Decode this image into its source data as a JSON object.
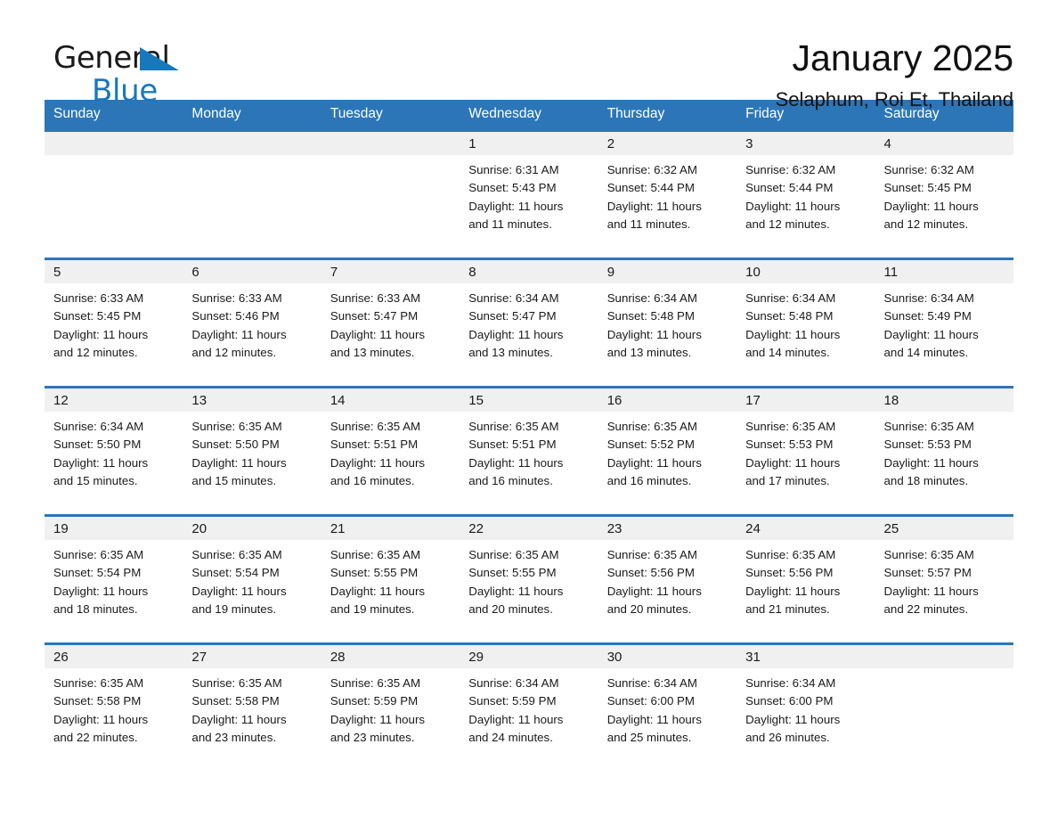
{
  "brand": {
    "name_part1": "General",
    "name_part2": "Blue",
    "accent_color": "#1878bd",
    "triangle_icon": "triangle-logo-icon"
  },
  "header": {
    "title": "January 2025",
    "location": "Selaphum, Roi Et, Thailand"
  },
  "calendar": {
    "header_bg": "#2c76b8",
    "daynum_bg": "#f0f0f0",
    "weekdays": [
      "Sunday",
      "Monday",
      "Tuesday",
      "Wednesday",
      "Thursday",
      "Friday",
      "Saturday"
    ],
    "weeks": [
      [
        {
          "day": "",
          "sunrise": "",
          "sunset": "",
          "daylight1": "",
          "daylight2": ""
        },
        {
          "day": "",
          "sunrise": "",
          "sunset": "",
          "daylight1": "",
          "daylight2": ""
        },
        {
          "day": "",
          "sunrise": "",
          "sunset": "",
          "daylight1": "",
          "daylight2": ""
        },
        {
          "day": "1",
          "sunrise": "Sunrise: 6:31 AM",
          "sunset": "Sunset: 5:43 PM",
          "daylight1": "Daylight: 11 hours",
          "daylight2": "and 11 minutes."
        },
        {
          "day": "2",
          "sunrise": "Sunrise: 6:32 AM",
          "sunset": "Sunset: 5:44 PM",
          "daylight1": "Daylight: 11 hours",
          "daylight2": "and 11 minutes."
        },
        {
          "day": "3",
          "sunrise": "Sunrise: 6:32 AM",
          "sunset": "Sunset: 5:44 PM",
          "daylight1": "Daylight: 11 hours",
          "daylight2": "and 12 minutes."
        },
        {
          "day": "4",
          "sunrise": "Sunrise: 6:32 AM",
          "sunset": "Sunset: 5:45 PM",
          "daylight1": "Daylight: 11 hours",
          "daylight2": "and 12 minutes."
        }
      ],
      [
        {
          "day": "5",
          "sunrise": "Sunrise: 6:33 AM",
          "sunset": "Sunset: 5:45 PM",
          "daylight1": "Daylight: 11 hours",
          "daylight2": "and 12 minutes."
        },
        {
          "day": "6",
          "sunrise": "Sunrise: 6:33 AM",
          "sunset": "Sunset: 5:46 PM",
          "daylight1": "Daylight: 11 hours",
          "daylight2": "and 12 minutes."
        },
        {
          "day": "7",
          "sunrise": "Sunrise: 6:33 AM",
          "sunset": "Sunset: 5:47 PM",
          "daylight1": "Daylight: 11 hours",
          "daylight2": "and 13 minutes."
        },
        {
          "day": "8",
          "sunrise": "Sunrise: 6:34 AM",
          "sunset": "Sunset: 5:47 PM",
          "daylight1": "Daylight: 11 hours",
          "daylight2": "and 13 minutes."
        },
        {
          "day": "9",
          "sunrise": "Sunrise: 6:34 AM",
          "sunset": "Sunset: 5:48 PM",
          "daylight1": "Daylight: 11 hours",
          "daylight2": "and 13 minutes."
        },
        {
          "day": "10",
          "sunrise": "Sunrise: 6:34 AM",
          "sunset": "Sunset: 5:48 PM",
          "daylight1": "Daylight: 11 hours",
          "daylight2": "and 14 minutes."
        },
        {
          "day": "11",
          "sunrise": "Sunrise: 6:34 AM",
          "sunset": "Sunset: 5:49 PM",
          "daylight1": "Daylight: 11 hours",
          "daylight2": "and 14 minutes."
        }
      ],
      [
        {
          "day": "12",
          "sunrise": "Sunrise: 6:34 AM",
          "sunset": "Sunset: 5:50 PM",
          "daylight1": "Daylight: 11 hours",
          "daylight2": "and 15 minutes."
        },
        {
          "day": "13",
          "sunrise": "Sunrise: 6:35 AM",
          "sunset": "Sunset: 5:50 PM",
          "daylight1": "Daylight: 11 hours",
          "daylight2": "and 15 minutes."
        },
        {
          "day": "14",
          "sunrise": "Sunrise: 6:35 AM",
          "sunset": "Sunset: 5:51 PM",
          "daylight1": "Daylight: 11 hours",
          "daylight2": "and 16 minutes."
        },
        {
          "day": "15",
          "sunrise": "Sunrise: 6:35 AM",
          "sunset": "Sunset: 5:51 PM",
          "daylight1": "Daylight: 11 hours",
          "daylight2": "and 16 minutes."
        },
        {
          "day": "16",
          "sunrise": "Sunrise: 6:35 AM",
          "sunset": "Sunset: 5:52 PM",
          "daylight1": "Daylight: 11 hours",
          "daylight2": "and 16 minutes."
        },
        {
          "day": "17",
          "sunrise": "Sunrise: 6:35 AM",
          "sunset": "Sunset: 5:53 PM",
          "daylight1": "Daylight: 11 hours",
          "daylight2": "and 17 minutes."
        },
        {
          "day": "18",
          "sunrise": "Sunrise: 6:35 AM",
          "sunset": "Sunset: 5:53 PM",
          "daylight1": "Daylight: 11 hours",
          "daylight2": "and 18 minutes."
        }
      ],
      [
        {
          "day": "19",
          "sunrise": "Sunrise: 6:35 AM",
          "sunset": "Sunset: 5:54 PM",
          "daylight1": "Daylight: 11 hours",
          "daylight2": "and 18 minutes."
        },
        {
          "day": "20",
          "sunrise": "Sunrise: 6:35 AM",
          "sunset": "Sunset: 5:54 PM",
          "daylight1": "Daylight: 11 hours",
          "daylight2": "and 19 minutes."
        },
        {
          "day": "21",
          "sunrise": "Sunrise: 6:35 AM",
          "sunset": "Sunset: 5:55 PM",
          "daylight1": "Daylight: 11 hours",
          "daylight2": "and 19 minutes."
        },
        {
          "day": "22",
          "sunrise": "Sunrise: 6:35 AM",
          "sunset": "Sunset: 5:55 PM",
          "daylight1": "Daylight: 11 hours",
          "daylight2": "and 20 minutes."
        },
        {
          "day": "23",
          "sunrise": "Sunrise: 6:35 AM",
          "sunset": "Sunset: 5:56 PM",
          "daylight1": "Daylight: 11 hours",
          "daylight2": "and 20 minutes."
        },
        {
          "day": "24",
          "sunrise": "Sunrise: 6:35 AM",
          "sunset": "Sunset: 5:56 PM",
          "daylight1": "Daylight: 11 hours",
          "daylight2": "and 21 minutes."
        },
        {
          "day": "25",
          "sunrise": "Sunrise: 6:35 AM",
          "sunset": "Sunset: 5:57 PM",
          "daylight1": "Daylight: 11 hours",
          "daylight2": "and 22 minutes."
        }
      ],
      [
        {
          "day": "26",
          "sunrise": "Sunrise: 6:35 AM",
          "sunset": "Sunset: 5:58 PM",
          "daylight1": "Daylight: 11 hours",
          "daylight2": "and 22 minutes."
        },
        {
          "day": "27",
          "sunrise": "Sunrise: 6:35 AM",
          "sunset": "Sunset: 5:58 PM",
          "daylight1": "Daylight: 11 hours",
          "daylight2": "and 23 minutes."
        },
        {
          "day": "28",
          "sunrise": "Sunrise: 6:35 AM",
          "sunset": "Sunset: 5:59 PM",
          "daylight1": "Daylight: 11 hours",
          "daylight2": "and 23 minutes."
        },
        {
          "day": "29",
          "sunrise": "Sunrise: 6:34 AM",
          "sunset": "Sunset: 5:59 PM",
          "daylight1": "Daylight: 11 hours",
          "daylight2": "and 24 minutes."
        },
        {
          "day": "30",
          "sunrise": "Sunrise: 6:34 AM",
          "sunset": "Sunset: 6:00 PM",
          "daylight1": "Daylight: 11 hours",
          "daylight2": "and 25 minutes."
        },
        {
          "day": "31",
          "sunrise": "Sunrise: 6:34 AM",
          "sunset": "Sunset: 6:00 PM",
          "daylight1": "Daylight: 11 hours",
          "daylight2": "and 26 minutes."
        },
        {
          "day": "",
          "sunrise": "",
          "sunset": "",
          "daylight1": "",
          "daylight2": ""
        }
      ]
    ]
  }
}
